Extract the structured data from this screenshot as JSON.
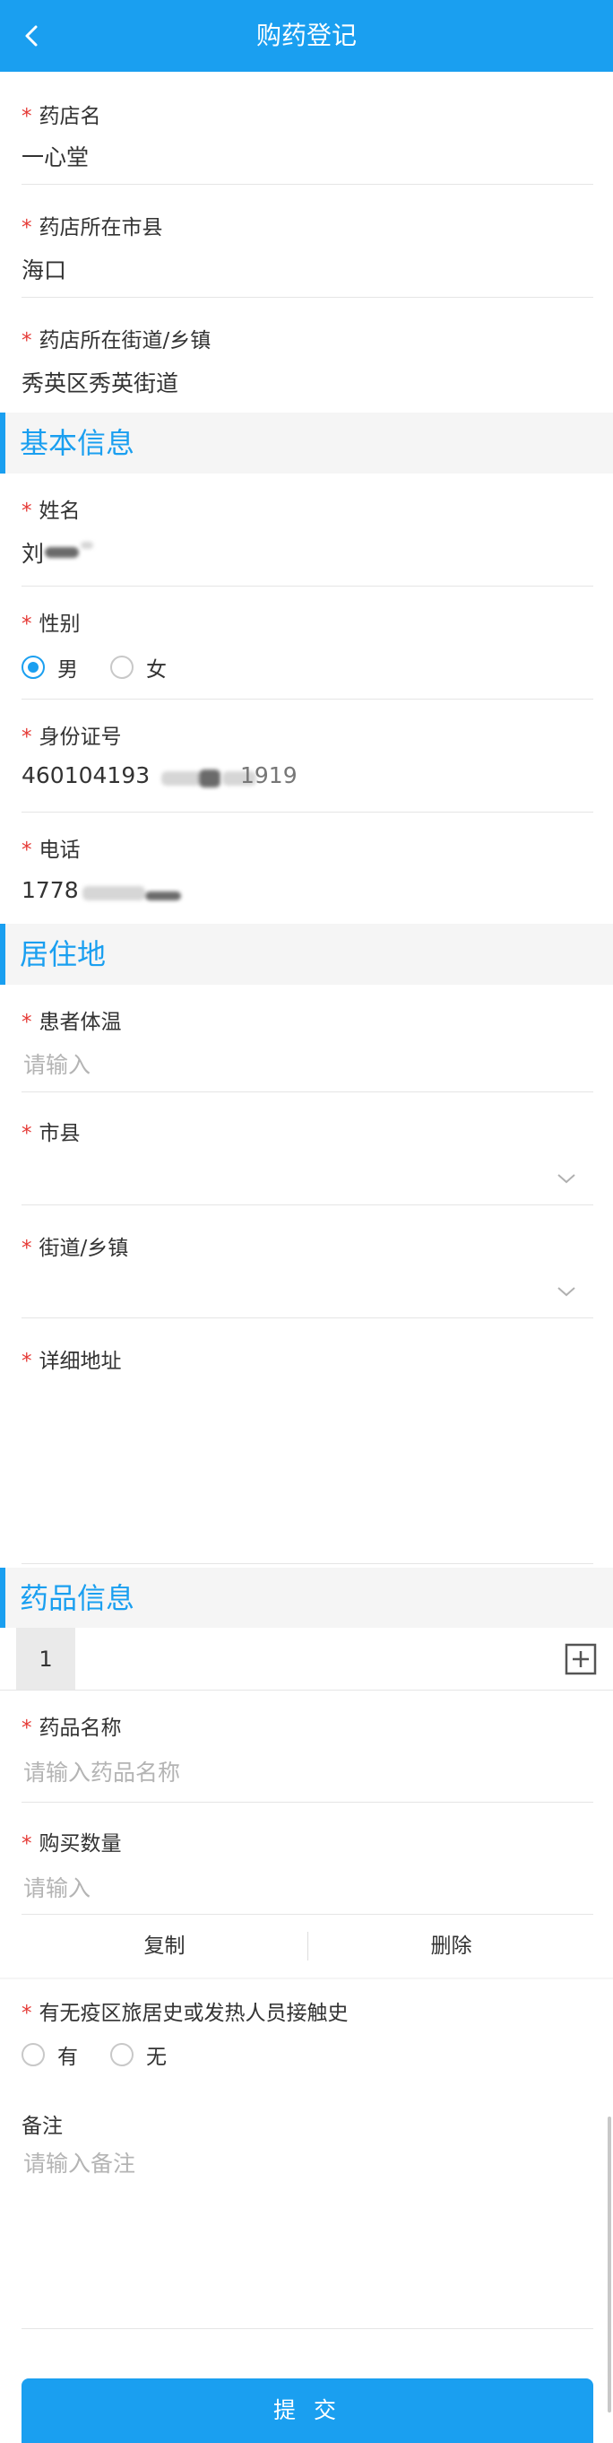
{
  "header": {
    "title": "购药登记",
    "back_icon": "chevron-left-icon"
  },
  "pharmacy": {
    "name_label": "药店名",
    "name_value": "一心堂",
    "city_label": "药店所在市县",
    "city_value": "海口",
    "street_label": "药店所在街道/乡镇",
    "street_value": "秀英区秀英街道"
  },
  "basic_info": {
    "section_title": "基本信息",
    "name_label": "姓名",
    "name_value": "刘",
    "gender_label": "性别",
    "gender_options": [
      "男",
      "女"
    ],
    "gender_selected": "男",
    "id_label": "身份证号",
    "id_value": "460104193",
    "id_value_tail": "1919",
    "phone_label": "电话",
    "phone_value": "1778"
  },
  "residence": {
    "section_title": "居住地",
    "temperature_label": "患者体温",
    "temperature_placeholder": "请输入",
    "city_label": "市县",
    "street_label": "街道/乡镇",
    "address_label": "详细地址"
  },
  "drug_info": {
    "section_title": "药品信息",
    "tab_label": "1",
    "add_icon": "plus-square-icon",
    "drug_name_label": "药品名称",
    "drug_name_placeholder": "请输入药品名称",
    "quantity_label": "购买数量",
    "quantity_placeholder": "请输入",
    "copy_label": "复制",
    "delete_label": "删除"
  },
  "epidemic": {
    "question_label": "有无疫区旅居史或发热人员接触史",
    "options": [
      "有",
      "无"
    ]
  },
  "remark": {
    "label": "备注",
    "placeholder": "请输入备注"
  },
  "submit_label": "提 交",
  "colors": {
    "accent": "#1a9ff0",
    "required_star": "#e53935",
    "placeholder": "#b4b4b4",
    "section_bg": "#f5f5f5"
  }
}
